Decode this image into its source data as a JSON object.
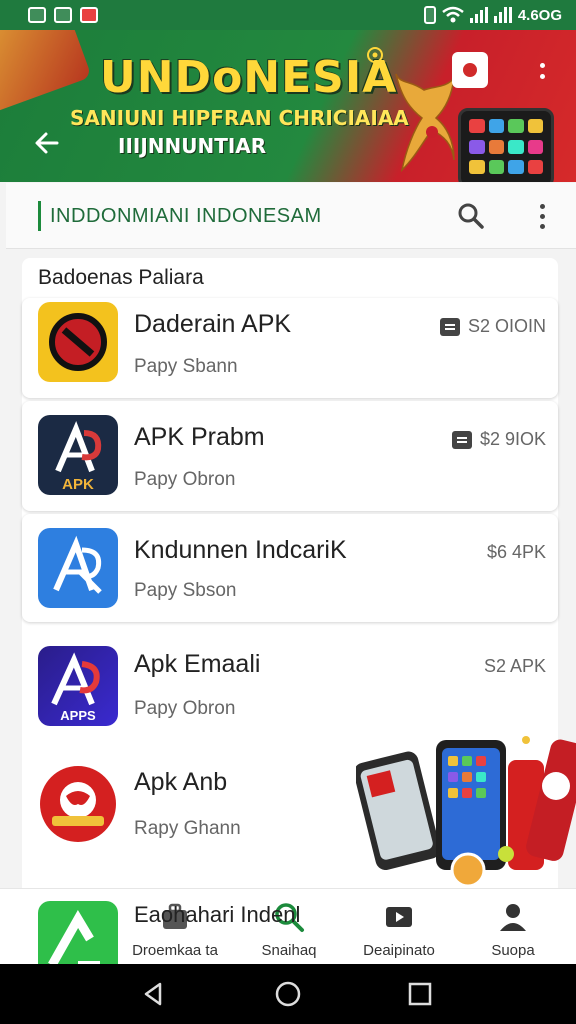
{
  "status_bar": {
    "time": "4.6OG"
  },
  "banner": {
    "title": "UNDoNESIA",
    "subtitle_1": "SANIUNI HIPFRAN CHRICIAIAA",
    "subtitle_2": "IIIJNNUNTIAR"
  },
  "search": {
    "text": "INDDONMIANI INDONESAM"
  },
  "section": {
    "title": "Badoenas Paliara"
  },
  "apps": [
    {
      "name": "Daderain APK",
      "subtitle": "Papy Sbann",
      "price": "S2 OIOIN",
      "badge": true
    },
    {
      "name": "APK Prabm",
      "subtitle": "Papy Obron",
      "price": "$2 9IOK",
      "badge": true
    },
    {
      "name": "Kndunnen IndcariK",
      "subtitle": "Papy Sbson",
      "price": "$6 4PK",
      "badge": false
    },
    {
      "name": "Apk Emaali",
      "subtitle": "Papy Obron",
      "price": "S2 APK",
      "badge": false
    },
    {
      "name": "Apk Anb",
      "subtitle": "Rapy Ghann",
      "price": "",
      "badge": false
    },
    {
      "name": "Eaohahari Indenl",
      "subtitle": "",
      "price": "",
      "badge": false
    }
  ],
  "app_icon_labels": {
    "app2": "APK",
    "app4": "APPS"
  },
  "bottom_nav": [
    {
      "label": "Droemkaa ta",
      "icon": "briefcase-icon"
    },
    {
      "label": "Snaihaq",
      "icon": "search-icon"
    },
    {
      "label": "Deaipinato",
      "icon": "play-icon"
    },
    {
      "label": "Suopa",
      "icon": "person-icon"
    }
  ],
  "colors": {
    "brand_green": "#1c8a3c",
    "brand_red": "#d02a2a",
    "banner_yellow": "#ffd83a"
  }
}
